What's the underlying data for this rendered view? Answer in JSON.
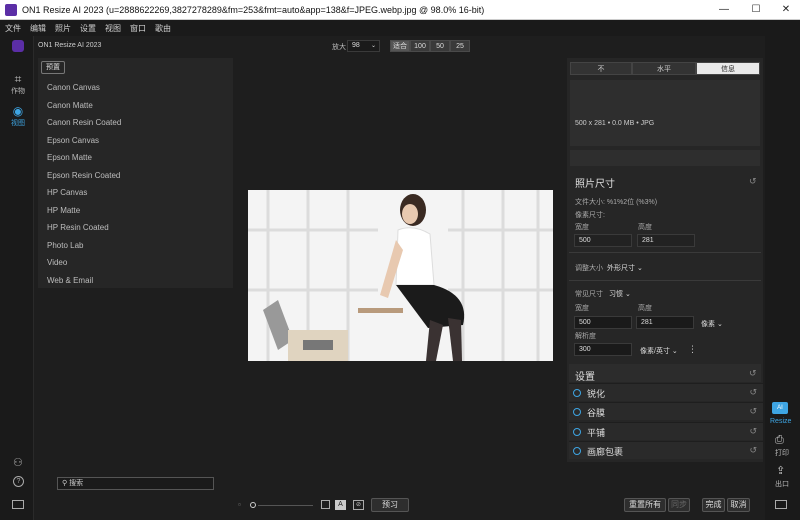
{
  "window": {
    "title": "ON1 Resize AI 2023 (u=2888622269,3827278289&fm=253&fmt=auto&app=138&f=JPEG.webp.jpg @ 98.0% 16-bit)",
    "min": "—",
    "max": "☐",
    "close": "✕"
  },
  "menu": [
    "文件",
    "编辑",
    "照片",
    "设置",
    "视图",
    "窗口",
    "歌由"
  ],
  "left_tools": {
    "crop": "作物",
    "view": "视图",
    "app_name": "ON1 Resize AI 2023"
  },
  "zoom": {
    "label": "放大",
    "value": "98",
    "fit": "适合",
    "z100": "100",
    "z50": "50",
    "z25": "25"
  },
  "presets": {
    "button": "预置",
    "items": [
      "Canon Canvas",
      "Canon Matte",
      "Canon Resin Coated",
      "Epson Canvas",
      "Epson Matte",
      "Epson Resin Coated",
      "HP Canvas",
      "HP Matte",
      "HP Resin Coated",
      "Photo Lab",
      "Video",
      "Web & Email"
    ]
  },
  "right_tabs": [
    "不",
    "水平",
    "信息"
  ],
  "info": {
    "text": "500 x 281 • 0.0 MB • JPG"
  },
  "photo_size": {
    "heading": "照片尺寸",
    "filesize": "文件大小: %1%2位 (%3%)",
    "pixel_size": "像素尺寸:",
    "width_label": "宽度",
    "height_label": "高度",
    "width": "500",
    "height": "281",
    "resize_label": "调整大小",
    "resize_value": "外形尺寸",
    "common_label": "常见尺寸",
    "common_value": "习惯",
    "w2_label": "宽度",
    "h2_label": "高度",
    "w2": "500",
    "h2": "281",
    "unit": "像素",
    "res_label": "解析度",
    "res": "300",
    "res_unit": "像素/英寸"
  },
  "settings": {
    "heading": "设置",
    "items": [
      "锐化",
      "谷膜",
      "平铺",
      "画廊包裹"
    ]
  },
  "right_icons": {
    "resize": "Resize",
    "print": "打印",
    "export": "出口"
  },
  "bottom": {
    "search_placeholder": "搜索",
    "preview": "预习",
    "reset_all": "重置所有",
    "sync": "同步",
    "done": "完成",
    "cancel": "取消"
  }
}
